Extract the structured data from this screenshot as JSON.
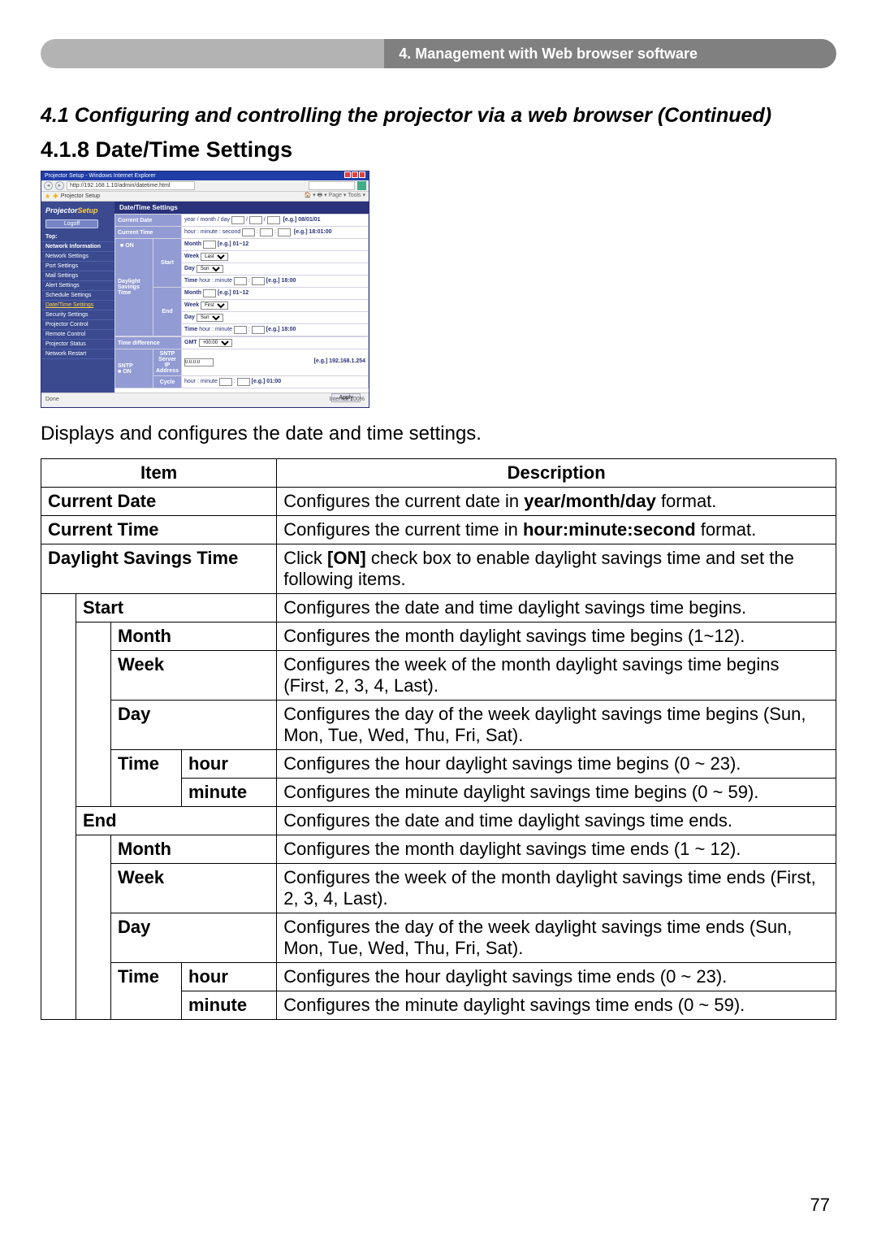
{
  "header": {
    "chapter": "4. Management with Web browser software"
  },
  "section": {
    "title": "4.1 Configuring and controlling the projector via a web browser (Continued)",
    "subtitle": "4.1.8 Date/Time Settings"
  },
  "screenshot": {
    "win_title": "Projector Setup - Windows Internet Explorer",
    "url": "http://192.168.1.10/admin/datetime.html",
    "tab": "Projector Setup",
    "side_logo_a": "Projector",
    "side_logo_b": "Setup",
    "logoff": "Logoff",
    "nav": {
      "top": "Top:",
      "network_info": "Network Information",
      "network_settings": "Network Settings",
      "port_settings": "Port Settings",
      "mail_settings": "Mail Settings",
      "alert_settings": "Alert Settings",
      "schedule_settings": "Schedule Settings",
      "datetime_settings": "Date/Time Settings",
      "security_settings": "Security Settings",
      "projector_control": "Projector Control",
      "remote_control": "Remote Control",
      "projector_status": "Projector Status",
      "network_restart": "Network Restart"
    },
    "panel_title": "Date/Time Settings",
    "form": {
      "current_date": "Current Date",
      "ymd": "year / month / day",
      "ymd_eg": "[e.g.] 08/01/01",
      "current_time": "Current Time",
      "hms": "hour : minute : second",
      "hms_eg": "[e.g.] 18:01:00",
      "dst": "Daylight Savings Time",
      "on1": "ON",
      "start": "Start",
      "end": "End",
      "month": "Month",
      "month_eg": "[e.g.] 01~12",
      "week": "Week",
      "day": "Day",
      "time": "Time",
      "time_hm": "hour : minute",
      "time_eg": "[e.g.] 18:00",
      "time_diff": "Time difference",
      "gmt": "GMT",
      "sntp": "SNTP",
      "sntp_on": "ON",
      "sntp_ip": "SNTP Server IP Address",
      "sntp_val": "0.0.0.0",
      "sntp_eg": "[e.g.] 192.168.1.254",
      "cycle": "Cycle",
      "cycle_hm": "hour : minute",
      "cycle_eg": "[e.g.] 01:00"
    },
    "apply": "Apply",
    "status_left": "Done",
    "status_right": "Internet        100%"
  },
  "intro": "Displays and configures the date and time settings.",
  "table": {
    "h_item": "Item",
    "h_desc": "Description",
    "rows": {
      "current_date": {
        "item": "Current Date",
        "desc_a": "Configures the current date in ",
        "desc_b": "year/month/day",
        "desc_c": " format."
      },
      "current_time": {
        "item": "Current Time",
        "desc_a": "Configures the current time in ",
        "desc_b": "hour:minute:second",
        "desc_c": " format."
      },
      "dst": {
        "item": "Daylight Savings Time",
        "desc_a": "Click ",
        "desc_b": "[ON]",
        "desc_c": " check box to enable daylight savings time and set the following items."
      },
      "start": {
        "item": "Start",
        "desc": "Configures the date and time daylight savings time begins."
      },
      "s_month": {
        "item": "Month",
        "desc": "Configures the month daylight savings time begins (1~12)."
      },
      "s_week": {
        "item": "Week",
        "desc": "Configures the week of the month daylight savings time begins (First, 2, 3, 4, Last)."
      },
      "s_day": {
        "item": "Day",
        "desc": "Configures the day of the week daylight savings time begins (Sun, Mon, Tue, Wed, Thu, Fri, Sat)."
      },
      "s_time": {
        "item": "Time"
      },
      "s_hour": {
        "item": "hour",
        "desc": "Configures the hour daylight savings time begins (0 ~ 23)."
      },
      "s_minute": {
        "item": "minute",
        "desc": "Configures the minute daylight savings time begins (0 ~ 59)."
      },
      "end": {
        "item": "End",
        "desc": "Configures the date and time daylight savings time ends."
      },
      "e_month": {
        "item": "Month",
        "desc": "Configures the month daylight savings time ends (1 ~ 12)."
      },
      "e_week": {
        "item": "Week",
        "desc": "Configures the week of the month daylight savings time ends (First, 2, 3, 4, Last)."
      },
      "e_day": {
        "item": "Day",
        "desc": "Configures the day of the week daylight savings time ends (Sun, Mon, Tue, Wed, Thu, Fri, Sat)."
      },
      "e_time": {
        "item": "Time"
      },
      "e_hour": {
        "item": "hour",
        "desc": "Configures the hour daylight savings time ends (0 ~ 23)."
      },
      "e_minute": {
        "item": "minute",
        "desc": "Configures the minute daylight savings time ends (0 ~ 59)."
      }
    }
  },
  "page_number": "77"
}
